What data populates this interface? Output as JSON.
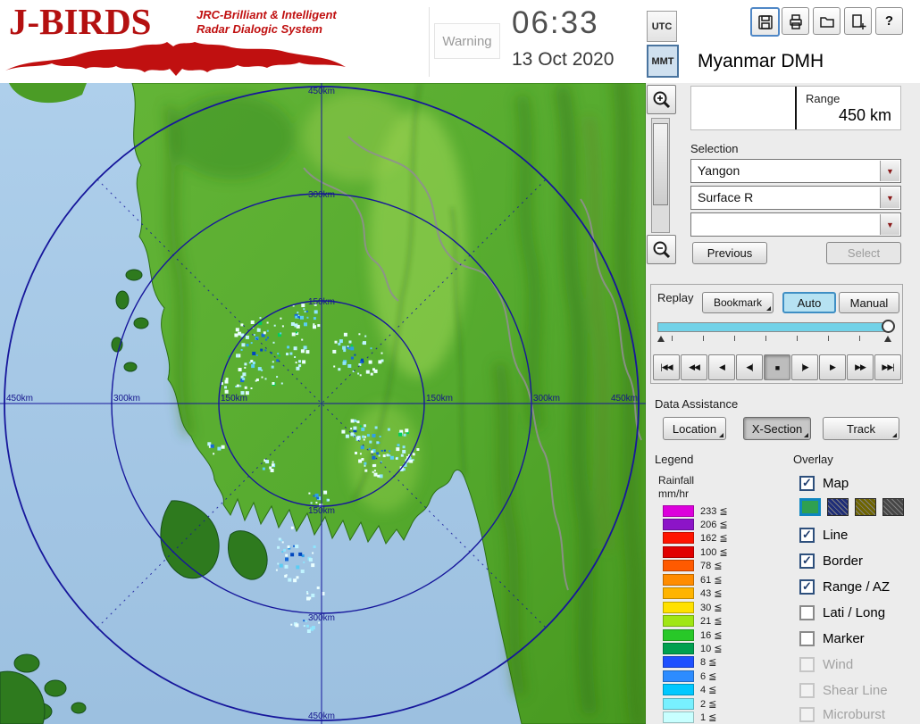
{
  "header": {
    "logo_title": "J-BIRDS",
    "logo_tagline1": "JRC-Brilliant & Intelligent",
    "logo_tagline2": "Radar  Dialogic  System",
    "warning": "Warning",
    "time": "06:33",
    "date": "13 Oct 2020",
    "utc": "UTC",
    "mmt": "MMT",
    "station": "Myanmar DMH",
    "help": "?"
  },
  "range_panel": {
    "label": "Range",
    "value": "450 km"
  },
  "selection": {
    "label": "Selection",
    "site": "Yangon",
    "product": "Surface R",
    "extra": "",
    "previous": "Previous",
    "select": "Select"
  },
  "replay": {
    "label": "Replay",
    "bookmark": "Bookmark",
    "auto": "Auto",
    "manual": "Manual",
    "controls": [
      "|◀◀",
      "◀◀",
      "◀",
      "◀|",
      "■",
      "|▶",
      "▶",
      "▶▶",
      "▶▶|"
    ]
  },
  "data_assistance": {
    "label": "Data Assistance",
    "location": "Location",
    "xsection": "X-Section",
    "track": "Track"
  },
  "legend": {
    "title": "Legend",
    "unit1": "Rainfall",
    "unit2": "mm/hr",
    "entries": [
      {
        "color": "#dc00dc",
        "label": "233 ≦"
      },
      {
        "color": "#8c14c8",
        "label": "206 ≦"
      },
      {
        "color": "#ff1400",
        "label": "162 ≦"
      },
      {
        "color": "#e10000",
        "label": "100 ≦"
      },
      {
        "color": "#ff5a00",
        "label": "78 ≦"
      },
      {
        "color": "#ff8c00",
        "label": "61 ≦"
      },
      {
        "color": "#ffb400",
        "label": "43 ≦"
      },
      {
        "color": "#ffe100",
        "label": "30 ≦"
      },
      {
        "color": "#a0e614",
        "label": "21 ≦"
      },
      {
        "color": "#28c828",
        "label": "16 ≦"
      },
      {
        "color": "#00a050",
        "label": "10 ≦"
      },
      {
        "color": "#1e50ff",
        "label": "8 ≦"
      },
      {
        "color": "#2d8cff",
        "label": "6 ≦"
      },
      {
        "color": "#00c8ff",
        "label": "4 ≦"
      },
      {
        "color": "#78f0ff",
        "label": "2 ≦"
      },
      {
        "color": "#c8ffff",
        "label": "1 ≦"
      }
    ]
  },
  "overlay": {
    "title": "Overlay",
    "items": [
      {
        "label": "Map",
        "checked": true,
        "enabled": true,
        "swatches": [
          "#2fa050",
          "#1e2d78",
          "#6e6400",
          "#464646"
        ]
      },
      {
        "label": "Line",
        "checked": true,
        "enabled": true
      },
      {
        "label": "Border",
        "checked": true,
        "enabled": true
      },
      {
        "label": "Range / AZ",
        "checked": true,
        "enabled": true
      },
      {
        "label": "Lati / Long",
        "checked": false,
        "enabled": true
      },
      {
        "label": "Marker",
        "checked": false,
        "enabled": true
      },
      {
        "label": "Wind",
        "checked": false,
        "enabled": false
      },
      {
        "label": "Shear Line",
        "checked": false,
        "enabled": false
      },
      {
        "label": "Microburst",
        "checked": false,
        "enabled": false
      }
    ]
  },
  "map": {
    "ring_labels": {
      "r150": "150km",
      "r300": "300km",
      "r450": "450km"
    }
  },
  "colors": {
    "sea": "#a5c8e6",
    "ring": "#16169b",
    "accent": "#72d2e8"
  }
}
